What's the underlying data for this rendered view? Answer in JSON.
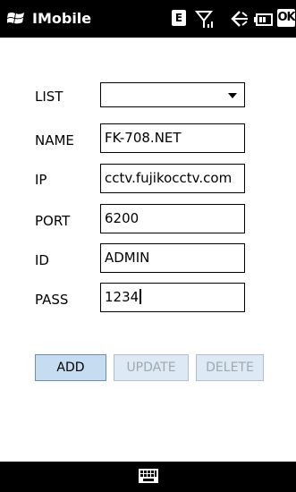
{
  "statusbar": {
    "app_title": "IMobile",
    "network_badge": "E",
    "ok_label": "OK",
    "icons": [
      "windows-logo-icon",
      "signal-icon",
      "speaker-muted-icon",
      "battery-icon"
    ]
  },
  "form": {
    "list_label": "LIST",
    "list_value": "",
    "name_label": "NAME",
    "name_value": "FK-708.NET",
    "ip_label": "IP",
    "ip_value": "cctv.fujikocctv.com",
    "port_label": "PORT",
    "port_value": "6200",
    "id_label": "ID",
    "id_value": "ADMIN",
    "pass_label": "PASS",
    "pass_value": "1234"
  },
  "buttons": {
    "add_label": "ADD",
    "update_label": "UPDATE",
    "delete_label": "DELETE"
  },
  "bottombar": {
    "icons": [
      "keyboard-icon"
    ]
  },
  "colors": {
    "bar_background": "#000000",
    "primary_button": "#c6dcf0",
    "disabled_button": "#dde9f4",
    "disabled_text": "#a0a8b0"
  }
}
